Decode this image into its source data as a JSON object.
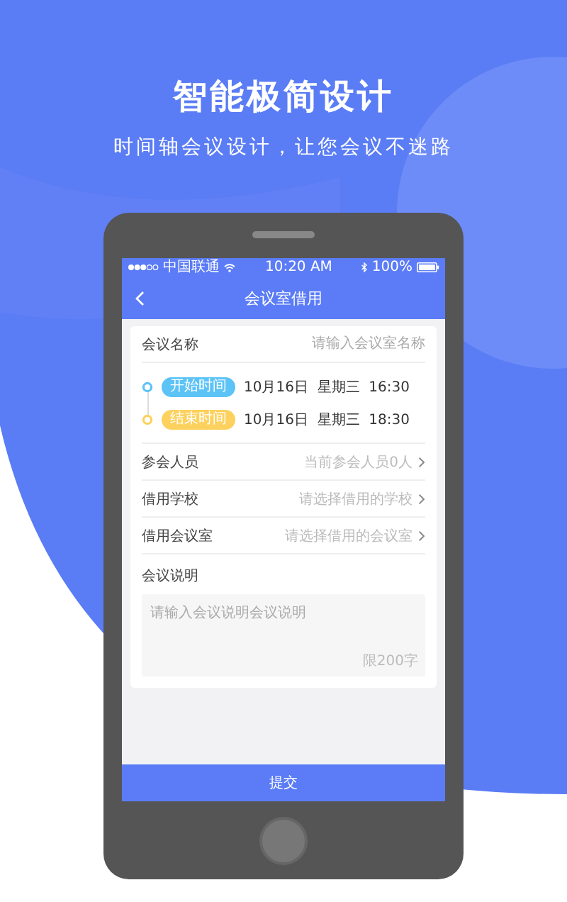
{
  "headline": "智能极简设计",
  "subheadline": "时间轴会议设计，让您会议不迷路",
  "status_bar": {
    "carrier": "中国联通",
    "time": "10:20 AM",
    "battery": "100%"
  },
  "nav": {
    "title": "会议室借用"
  },
  "name_field": {
    "label": "会议名称",
    "placeholder": "请输入会议室名称"
  },
  "times": [
    {
      "label": "开始时间",
      "color": "#5cc3f7",
      "date": "10月16日",
      "weekday": "星期三",
      "time": "16:30"
    },
    {
      "label": "结束时间",
      "color": "#fcd15e",
      "date": "10月16日",
      "weekday": "星期三",
      "time": "18:30"
    }
  ],
  "rows": [
    {
      "label": "参会人员",
      "placeholder": "当前参会人员0人"
    },
    {
      "label": "借用学校",
      "placeholder": "请选择借用的学校"
    },
    {
      "label": "借用会议室",
      "placeholder": "请选择借用的会议室"
    }
  ],
  "description": {
    "label": "会议说明",
    "placeholder": "请输入会议说明会议说明",
    "limit": "限200字"
  },
  "submit": "提交"
}
